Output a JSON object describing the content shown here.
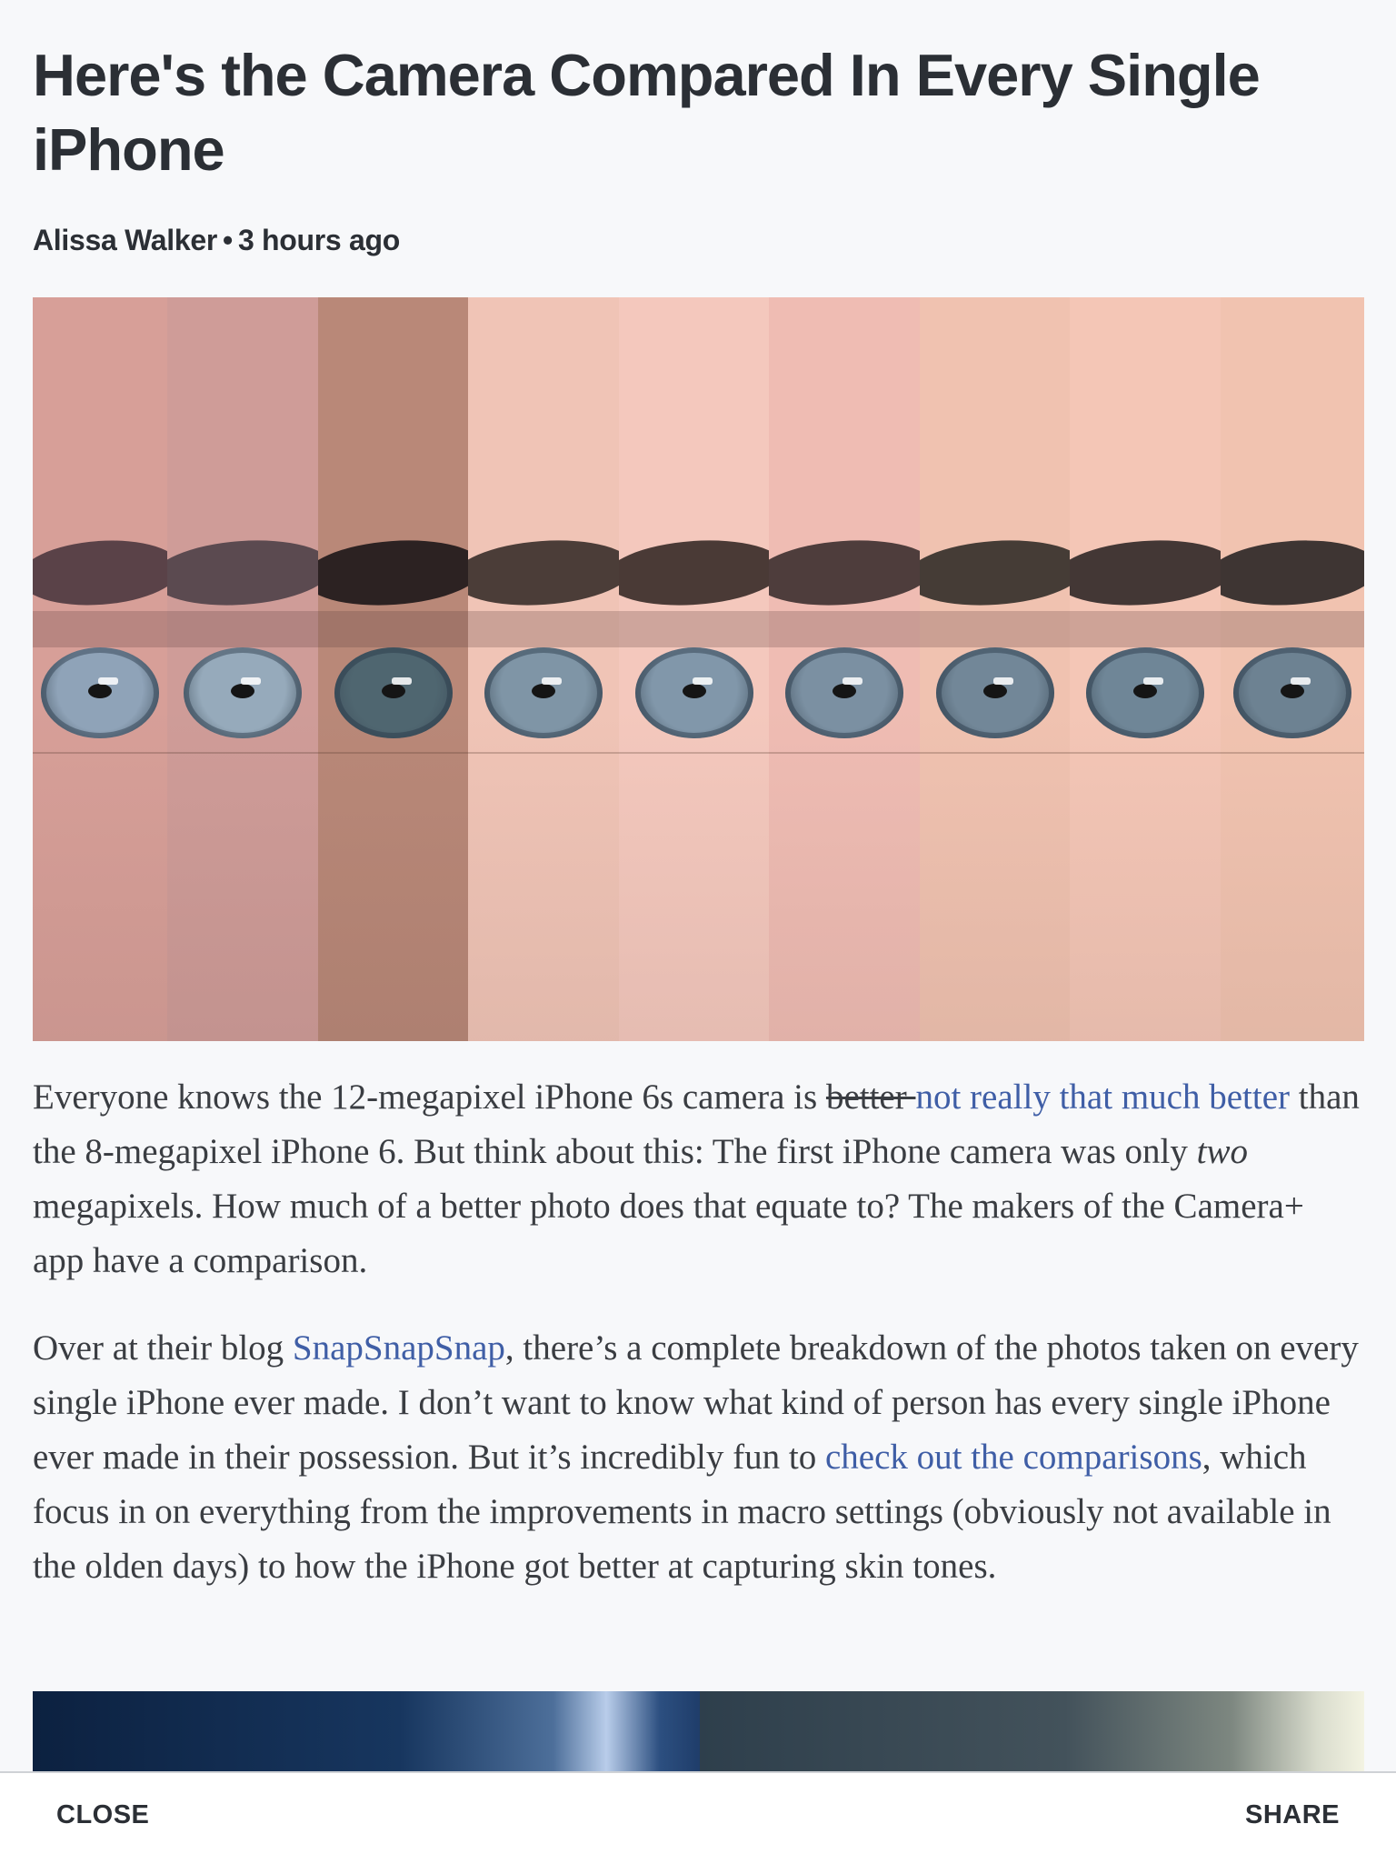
{
  "article": {
    "title": "Here's the Camera Compared In Every Single iPhone",
    "author": "Alissa Walker",
    "separator": "•",
    "time": "3 hours ago"
  },
  "hero_strips": [
    {
      "skin": "#d79f98",
      "brow": "#5a4248",
      "iris": "#8fa3b8"
    },
    {
      "skin": "#cf9c98",
      "brow": "#5b4a50",
      "iris": "#96aabb"
    },
    {
      "skin": "#b98878",
      "brow": "#2c2222",
      "iris": "#4f6670"
    },
    {
      "skin": "#f0c4b6",
      "brow": "#4b3d38",
      "iris": "#7f95a6"
    },
    {
      "skin": "#f4c8bd",
      "brow": "#4a3a36",
      "iris": "#8197aa"
    },
    {
      "skin": "#efbcb3",
      "brow": "#4e3d3c",
      "iris": "#7b90a2"
    },
    {
      "skin": "#f0c2b0",
      "brow": "#453c36",
      "iris": "#728798"
    },
    {
      "skin": "#f4c6b6",
      "brow": "#433735",
      "iris": "#6f8697"
    },
    {
      "skin": "#f1c3b0",
      "brow": "#3e3533",
      "iris": "#6d8292"
    }
  ],
  "paragraph1": {
    "t1": "Everyone knows the 12-megapixel iPhone 6s camera is ",
    "strike": "better ",
    "link": "not really that much better",
    "t2": " than the 8-megapixel iPhone 6. But think about this: The first iPhone camera was only ",
    "em": "two",
    "t3": " megapixels. How much of a better photo does that equate to? The makers of the Camera+ app have a comparison."
  },
  "paragraph2": {
    "t1": "Over at their blog ",
    "link1": "SnapSnapSnap",
    "t2": ", there’s a complete breakdown of the photos taken on every single iPhone ever made. I don’t want to know what kind of person has every single iPhone ever made in their possession. But it’s incredibly fun to ",
    "link2": "check out the comparisons",
    "t3": ", which focus in on everything from the improvements in macro settings (obviously not available in the olden days) to how the iPhone got better at capturing skin tones."
  },
  "bottom_bar": {
    "close_label": "CLOSE",
    "share_label": "SHARE"
  },
  "colors": {
    "link": "#3f5ea6",
    "text": "#3a3d42",
    "heading": "#2b2f35",
    "background": "#f7f8fa"
  }
}
